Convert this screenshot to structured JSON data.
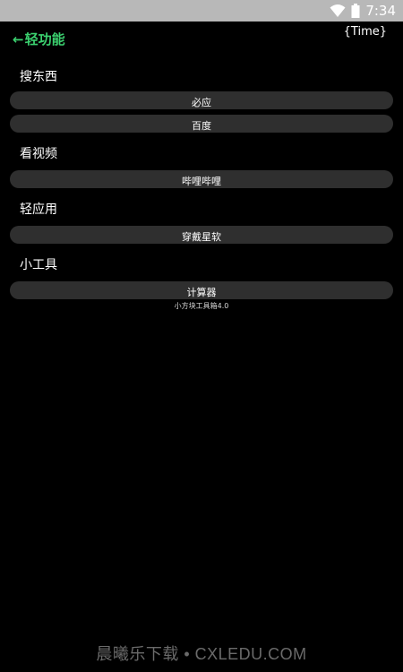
{
  "status_bar": {
    "time": "7:34",
    "icons": [
      "wifi-icon",
      "battery-icon"
    ],
    "background": "#b8b8b8"
  },
  "header": {
    "back_arrow": "←",
    "back_label": "轻功能",
    "time_placeholder": "{Time}",
    "accent": "#3bd16f"
  },
  "sections": [
    {
      "title": "搜东西",
      "items": [
        "必应",
        "百度"
      ]
    },
    {
      "title": "看视频",
      "items": [
        "哔哩哔哩"
      ]
    },
    {
      "title": "轻应用",
      "items": [
        "穿戴星软"
      ]
    },
    {
      "title": "小工具",
      "items": [
        "计算器"
      ]
    }
  ],
  "footer_note": "小方块工具箱4.0",
  "watermark": "晨曦乐下载 • CXLEDU.COM"
}
